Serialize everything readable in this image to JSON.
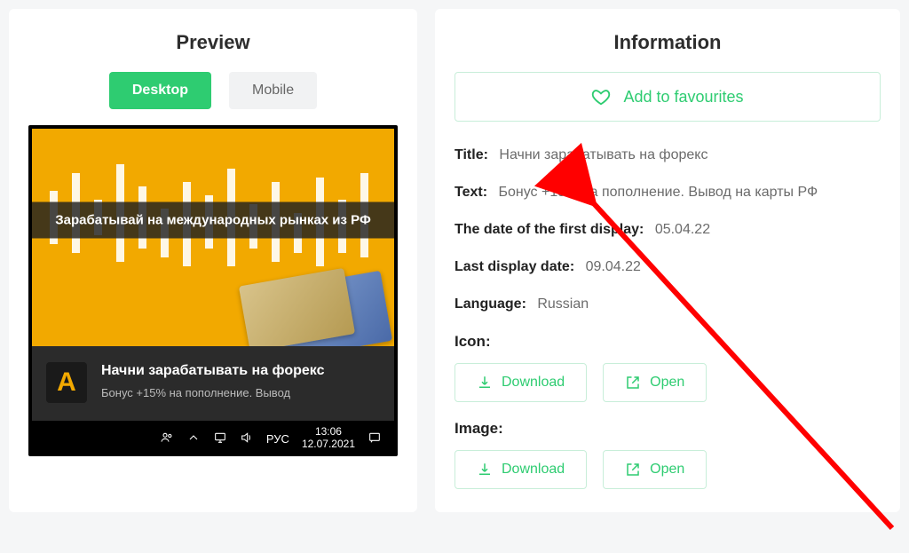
{
  "preview": {
    "heading": "Preview",
    "tabs": {
      "desktop": "Desktop",
      "mobile": "Mobile"
    },
    "ad_banner_text": "Зарабатывай на международных рынках из РФ",
    "notification": {
      "icon_letter": "A",
      "title": "Начни зарабатывать на форекс",
      "desc": "Бонус +15% на пополнение. Вывод"
    },
    "taskbar": {
      "lang": "РУС",
      "time": "13:06",
      "date": "12.07.2021"
    }
  },
  "info": {
    "heading": "Information",
    "fav_label": "Add to favourites",
    "fields": {
      "title_label": "Title:",
      "title_value": "Начни зарабатывать на форекс",
      "text_label": "Text:",
      "text_value": "Бонус +15% на пополнение. Вывод на карты РФ",
      "first_display_label": "The date of the first display:",
      "first_display_value": "05.04.22",
      "last_display_label": "Last display date:",
      "last_display_value": "09.04.22",
      "language_label": "Language:",
      "language_value": "Russian"
    },
    "icon_section": "Icon:",
    "image_section": "Image:",
    "download_label": "Download",
    "open_label": "Open"
  }
}
